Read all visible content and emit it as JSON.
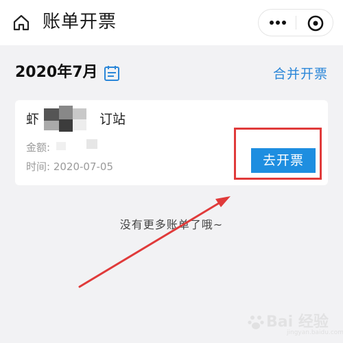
{
  "header": {
    "title": "账单开票",
    "icons": {
      "home": "home-icon",
      "more": "more-dots-icon",
      "close": "close-mini-program-icon"
    }
  },
  "month": {
    "label": "2020年7月",
    "calendar_icon": "calendar-icon",
    "merge_label": "合并开票"
  },
  "bill": {
    "merchant_prefix": "虾",
    "merchant_suffix": "订站",
    "amount_label": "金额:",
    "time_label": "时间:",
    "time_value": "2020-07-05",
    "invoice_button": "去开票"
  },
  "footer": {
    "no_more": "没有更多账单了哦~"
  },
  "watermark": {
    "text": "Bai 经验",
    "sub": "jingyan.baidu.com"
  },
  "colors": {
    "accent": "#1e8ee0",
    "link": "#2a86d8",
    "annotation": "#e03a3a",
    "background": "#f2f2f4"
  }
}
